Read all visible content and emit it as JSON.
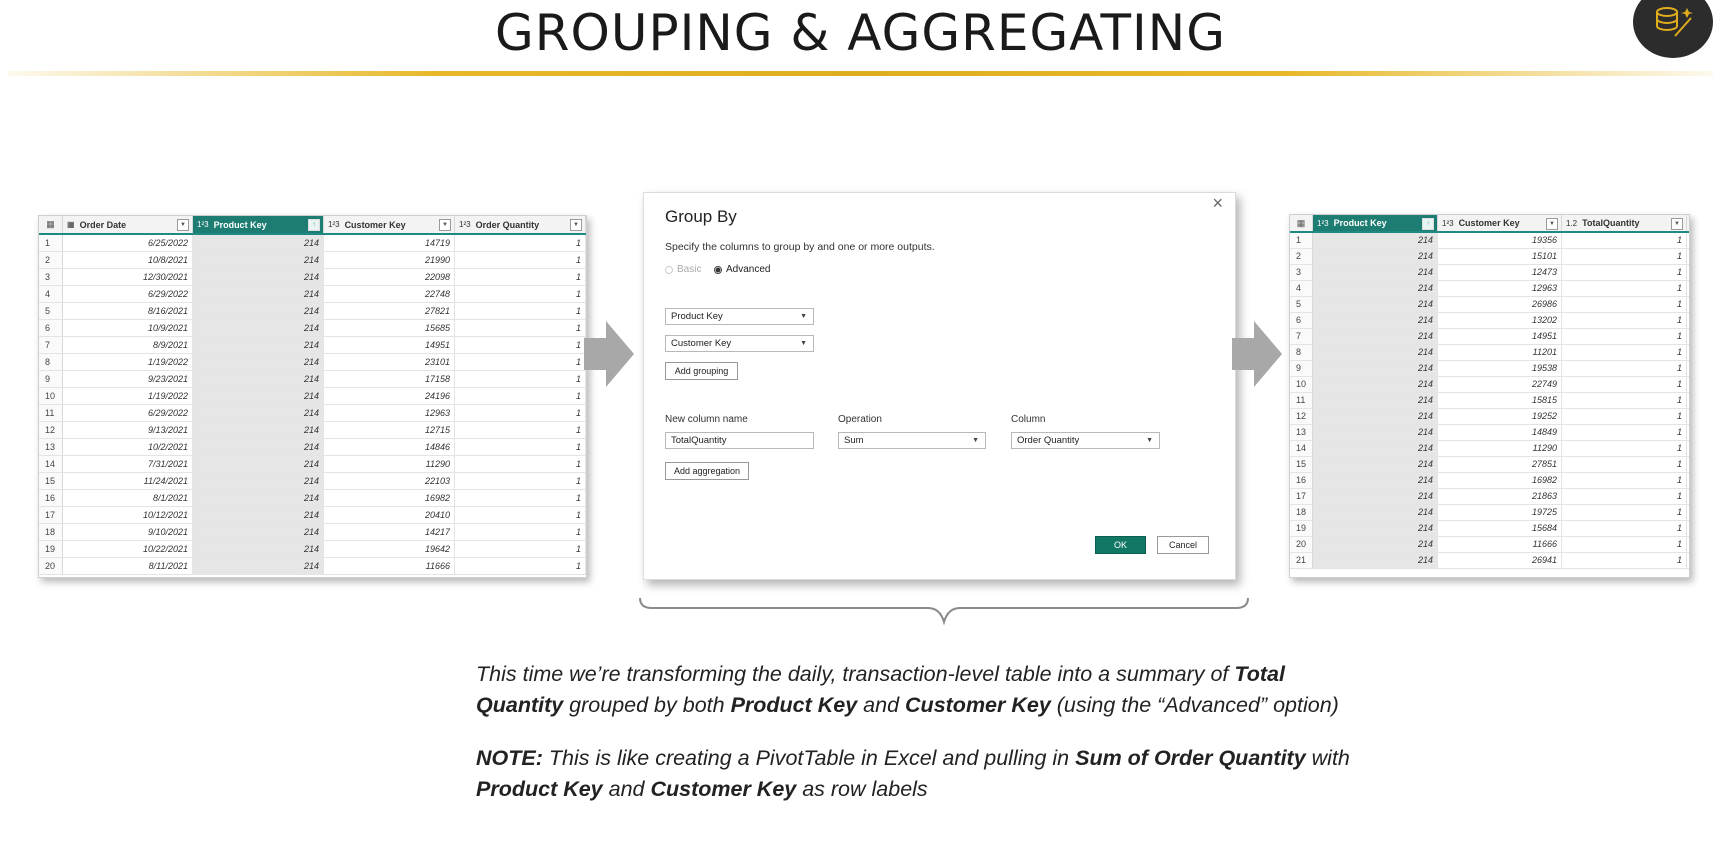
{
  "title": "GROUPING & AGGREGATING",
  "left_table": {
    "columns": [
      {
        "type": "",
        "label": "Order Date"
      },
      {
        "type": "1²3",
        "label": "Product Key"
      },
      {
        "type": "1²3",
        "label": "Customer Key"
      },
      {
        "type": "1²3",
        "label": "Order Quantity"
      }
    ],
    "rows": [
      [
        "1",
        "6/25/2022",
        "214",
        "14719",
        "1"
      ],
      [
        "2",
        "10/8/2021",
        "214",
        "21990",
        "1"
      ],
      [
        "3",
        "12/30/2021",
        "214",
        "22098",
        "1"
      ],
      [
        "4",
        "6/29/2022",
        "214",
        "22748",
        "1"
      ],
      [
        "5",
        "8/16/2021",
        "214",
        "27821",
        "1"
      ],
      [
        "6",
        "10/9/2021",
        "214",
        "15685",
        "1"
      ],
      [
        "7",
        "8/9/2021",
        "214",
        "14951",
        "1"
      ],
      [
        "8",
        "1/19/2022",
        "214",
        "23101",
        "1"
      ],
      [
        "9",
        "9/23/2021",
        "214",
        "17158",
        "1"
      ],
      [
        "10",
        "1/19/2022",
        "214",
        "24196",
        "1"
      ],
      [
        "11",
        "6/29/2022",
        "214",
        "12963",
        "1"
      ],
      [
        "12",
        "9/13/2021",
        "214",
        "12715",
        "1"
      ],
      [
        "13",
        "10/2/2021",
        "214",
        "14846",
        "1"
      ],
      [
        "14",
        "7/31/2021",
        "214",
        "11290",
        "1"
      ],
      [
        "15",
        "11/24/2021",
        "214",
        "22103",
        "1"
      ],
      [
        "16",
        "8/1/2021",
        "214",
        "16982",
        "1"
      ],
      [
        "17",
        "10/12/2021",
        "214",
        "20410",
        "1"
      ],
      [
        "18",
        "9/10/2021",
        "214",
        "14217",
        "1"
      ],
      [
        "19",
        "10/22/2021",
        "214",
        "19642",
        "1"
      ],
      [
        "20",
        "8/11/2021",
        "214",
        "11666",
        "1"
      ]
    ]
  },
  "dialog": {
    "title": "Group By",
    "close": "×",
    "subtitle": "Specify the columns to group by and one or more outputs.",
    "radio_basic": "Basic",
    "radio_advanced": "Advanced",
    "group1": "Product Key",
    "group2": "Customer Key",
    "add_grouping": "Add grouping",
    "new_column_label": "New column name",
    "operation_label": "Operation",
    "column_label": "Column",
    "new_column_value": "TotalQuantity",
    "operation_value": "Sum",
    "column_value": "Order Quantity",
    "add_aggregation": "Add aggregation",
    "ok": "OK",
    "cancel": "Cancel"
  },
  "right_table": {
    "columns": [
      {
        "type": "1²3",
        "label": "Product Key"
      },
      {
        "type": "1²3",
        "label": "Customer Key"
      },
      {
        "type": "1.2",
        "label": "TotalQuantity"
      }
    ],
    "rows": [
      [
        "1",
        "214",
        "19356",
        "1"
      ],
      [
        "2",
        "214",
        "15101",
        "1"
      ],
      [
        "3",
        "214",
        "12473",
        "1"
      ],
      [
        "4",
        "214",
        "12963",
        "1"
      ],
      [
        "5",
        "214",
        "26986",
        "1"
      ],
      [
        "6",
        "214",
        "13202",
        "1"
      ],
      [
        "7",
        "214",
        "14951",
        "1"
      ],
      [
        "8",
        "214",
        "11201",
        "1"
      ],
      [
        "9",
        "214",
        "19538",
        "1"
      ],
      [
        "10",
        "214",
        "22749",
        "1"
      ],
      [
        "11",
        "214",
        "15815",
        "1"
      ],
      [
        "12",
        "214",
        "19252",
        "1"
      ],
      [
        "13",
        "214",
        "14849",
        "1"
      ],
      [
        "14",
        "214",
        "11290",
        "1"
      ],
      [
        "15",
        "214",
        "27851",
        "1"
      ],
      [
        "16",
        "214",
        "16982",
        "1"
      ],
      [
        "17",
        "214",
        "21863",
        "1"
      ],
      [
        "18",
        "214",
        "19725",
        "1"
      ],
      [
        "19",
        "214",
        "15684",
        "1"
      ],
      [
        "20",
        "214",
        "11666",
        "1"
      ],
      [
        "21",
        "214",
        "26941",
        "1"
      ]
    ]
  },
  "caption1": {
    "p1": "This time we’re transforming the daily, transaction-level table into a summary of ",
    "b1": "Total",
    "b2": "Quantity",
    "p2": " grouped by both ",
    "b3": "Product Key",
    "p3": " and ",
    "b4": "Customer Key",
    "p4": " (using the “Advanced” option)"
  },
  "caption2": {
    "b1": "NOTE:",
    "p1": " This is like creating a PivotTable in Excel and pulling in ",
    "b2": "Sum of Order Quantity",
    "p2": " with",
    "b3": "Product Key",
    "p3": " and ",
    "b4": "Customer Key",
    "p4": " as row labels"
  },
  "colors": {
    "gold": "#e0ad1c",
    "teal_header": "#1e7d72",
    "ok_button": "#117865",
    "arrow": "#a8a8a8"
  }
}
